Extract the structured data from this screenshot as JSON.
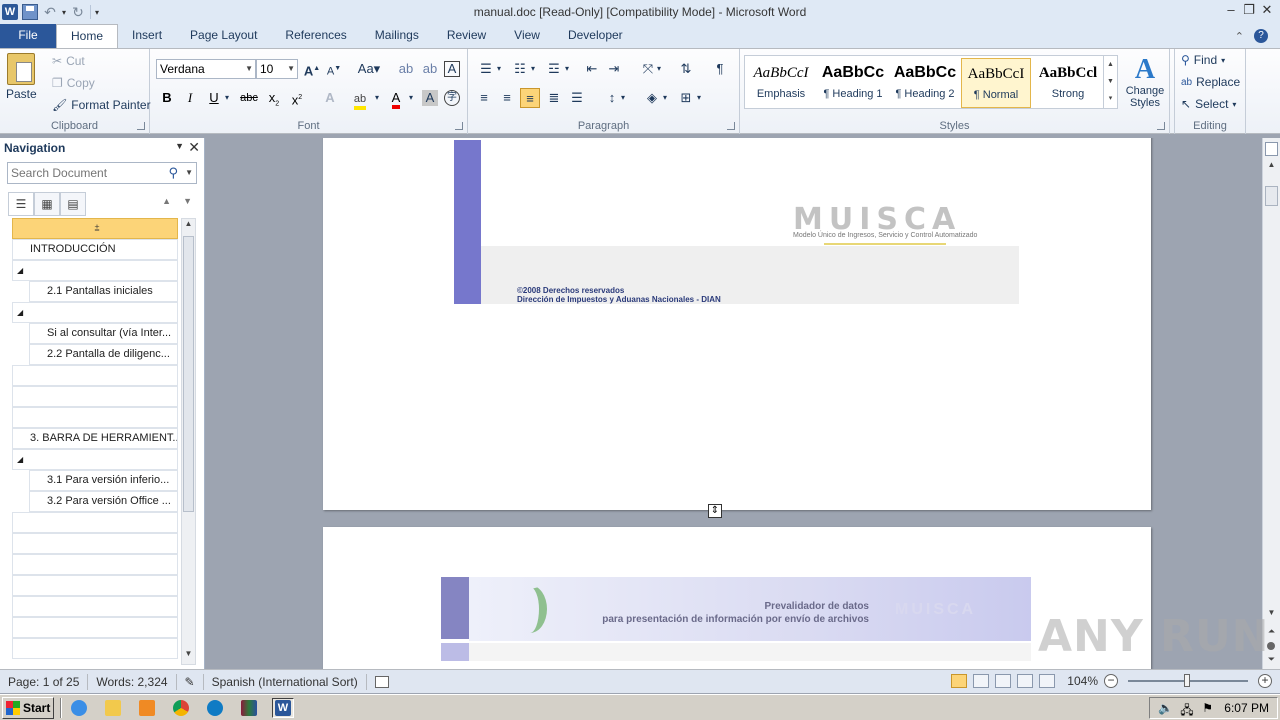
{
  "window": {
    "title": "manual.doc [Read-Only] [Compatibility Mode]  -  Microsoft Word",
    "app_icon_letter": "W"
  },
  "tabs": [
    "File",
    "Home",
    "Insert",
    "Page Layout",
    "References",
    "Mailings",
    "Review",
    "View",
    "Developer"
  ],
  "active_tab": "Home",
  "ribbon": {
    "clipboard": {
      "label": "Clipboard",
      "paste": "Paste",
      "cut": "Cut",
      "copy": "Copy",
      "format_painter": "Format Painter"
    },
    "font": {
      "label": "Font",
      "font_name": "Verdana",
      "font_size": "10"
    },
    "paragraph": {
      "label": "Paragraph"
    },
    "styles": {
      "label": "Styles",
      "items": [
        {
          "sample": "AaBbCcI",
          "name": "Emphasis"
        },
        {
          "sample": "AaBbCc",
          "name": "¶ Heading 1"
        },
        {
          "sample": "AaBbCc",
          "name": "¶ Heading 2"
        },
        {
          "sample": "AaBbCcI",
          "name": "¶ Normal"
        },
        {
          "sample": "AaBbCcl",
          "name": "Strong"
        }
      ],
      "selected": "¶ Normal",
      "change_styles": "Change Styles"
    },
    "editing": {
      "label": "Editing",
      "find": "Find",
      "replace": "Replace",
      "select": "Select"
    }
  },
  "navigation": {
    "title": "Navigation",
    "search_placeholder": "Search Document",
    "items": [
      {
        "text": "",
        "level": "top",
        "highlighted": true
      },
      {
        "text": "INTRODUCCIÓN",
        "level": "1"
      },
      {
        "text": "◢",
        "level": "1"
      },
      {
        "text": "2.1 Pantallas iniciales",
        "level": "2"
      },
      {
        "text": "◢",
        "level": "1"
      },
      {
        "text": "Si al consultar (vía Inter...",
        "level": "2"
      },
      {
        "text": "2.2 Pantalla de diligenc...",
        "level": "2"
      },
      {
        "text": "",
        "level": "1"
      },
      {
        "text": "",
        "level": "1"
      },
      {
        "text": "",
        "level": "1"
      },
      {
        "text": "3. BARRA DE HERRAMIENT...",
        "level": "1"
      },
      {
        "text": "◢",
        "level": "1"
      },
      {
        "text": "3.1 Para versión inferio...",
        "level": "2"
      },
      {
        "text": "3.2 Para versión Office ...",
        "level": "2"
      },
      {
        "text": "",
        "level": "1"
      },
      {
        "text": "",
        "level": "1"
      },
      {
        "text": "",
        "level": "1"
      },
      {
        "text": "",
        "level": "1"
      },
      {
        "text": "",
        "level": "1"
      },
      {
        "text": "",
        "level": "1"
      },
      {
        "text": "",
        "level": "1"
      }
    ]
  },
  "document": {
    "page1": {
      "logo": "MUISCA",
      "logo_sub": "Modelo Único de Ingresos, Servicio y Control Automatizado",
      "rights_line1": "©2008 Derechos reservados",
      "rights_line2": "Dirección de Impuestos y Aduanas Nacionales - DIAN"
    },
    "page2": {
      "header_line1": "Prevalidador de datos",
      "header_line2": "para presentación de información por envío de archivos",
      "logo": "MUISCA"
    }
  },
  "statusbar": {
    "page": "Page: 1 of 25",
    "words": "Words: 2,324",
    "language": "Spanish (International Sort)",
    "zoom": "104%"
  },
  "taskbar": {
    "start": "Start",
    "clock": "6:07 PM"
  },
  "watermark": "ANY RUN",
  "colors": {
    "accent": "#2b579a",
    "nav_highlight": "#fcd478",
    "banner_purple": "#7677cc"
  }
}
